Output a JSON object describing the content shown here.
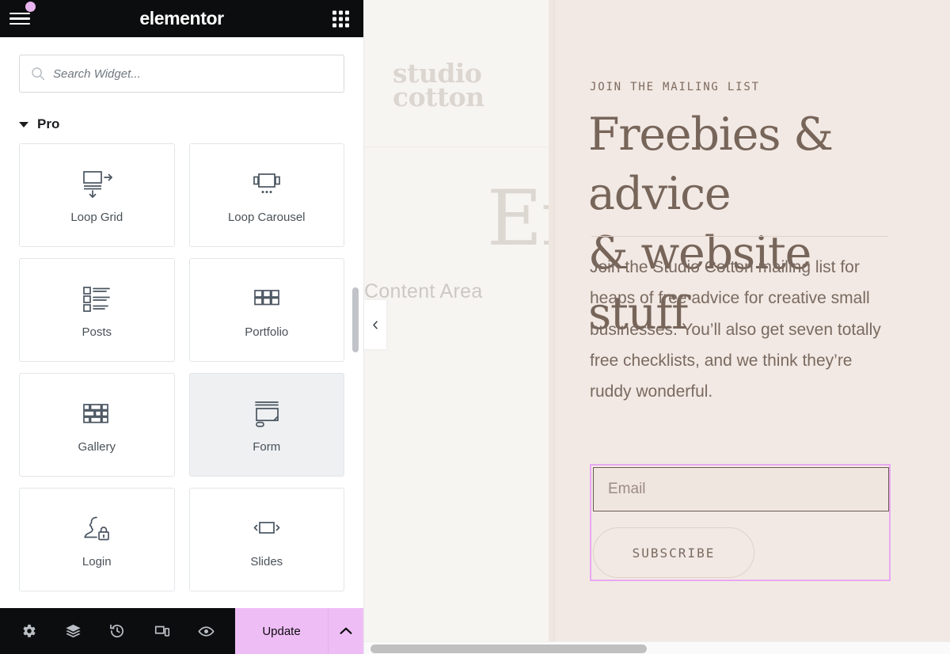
{
  "panel": {
    "header": {
      "brand": "elementor",
      "menu_icon": "hamburger-menu-icon",
      "badge": "notification-dot",
      "apps_icon": "apps-grid-icon"
    },
    "search": {
      "placeholder": "Search Widget...",
      "value": "",
      "icon": "search-icon"
    },
    "category": {
      "label": "Pro",
      "expanded": true,
      "caret_icon": "chevron-down-icon"
    },
    "widgets": [
      {
        "label": "Loop Grid",
        "icon": "loop-grid-icon",
        "active": false
      },
      {
        "label": "Loop Carousel",
        "icon": "loop-carousel-icon",
        "active": false
      },
      {
        "label": "Posts",
        "icon": "posts-icon",
        "active": false
      },
      {
        "label": "Portfolio",
        "icon": "portfolio-icon",
        "active": false
      },
      {
        "label": "Gallery",
        "icon": "gallery-icon",
        "active": false
      },
      {
        "label": "Form",
        "icon": "form-icon",
        "active": true
      },
      {
        "label": "Login",
        "icon": "login-icon",
        "active": false
      },
      {
        "label": "Slides",
        "icon": "slides-icon",
        "active": false
      }
    ],
    "footer": {
      "tools": [
        {
          "name": "settings-icon",
          "title": "Settings"
        },
        {
          "name": "navigator-icon",
          "title": "Navigator"
        },
        {
          "name": "history-icon",
          "title": "History"
        },
        {
          "name": "responsive-mode-icon",
          "title": "Responsive Mode"
        },
        {
          "name": "preview-icon",
          "title": "Preview Changes"
        }
      ],
      "update_label": "Update",
      "update_caret_icon": "chevron-up-icon"
    }
  },
  "preview": {
    "ghost": {
      "logo_line1": "studio",
      "logo_line2": "cotton",
      "big_text": "En",
      "content_area_label": "Content Area"
    },
    "section": {
      "eyebrow": "JOIN THE MAILING LIST",
      "headline_line1": "Freebies & advice",
      "headline_line2": "& website stuff",
      "body": "Join the Studio Cotton mailing list for heaps of free advice for creative small businesses. You’ll also get seven totally free checklists, and we think they’re ruddy wonderful.",
      "form": {
        "email_placeholder": "Email",
        "email_value": "",
        "submit_label": "SUBSCRIBE",
        "selected": true
      }
    },
    "collapse_handle_icon": "chevron-left-icon"
  },
  "colors": {
    "panel_header_bg": "#0c0d0e",
    "accent_pink": "#efbdf6",
    "selection_outline": "#e8a8f0",
    "preview_bg": "#f2e9e4",
    "ghost_bg": "#f7f5f2",
    "text_brown": "#77655a",
    "widget_label": "#495157"
  }
}
